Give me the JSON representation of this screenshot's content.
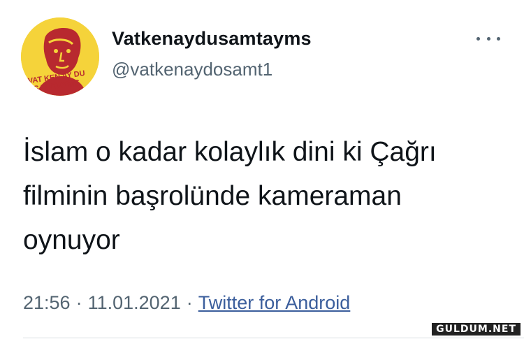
{
  "user": {
    "display_name": "Vatkenaydusamtayms",
    "handle": "@vatkenaydosamt1",
    "avatar_text": "VAT KEN AY DU SAMTAYMS",
    "avatar_bg": "#f5d33a",
    "avatar_text_color": "#b8292f"
  },
  "tweet": {
    "lines": [
      "İslam o kadar kolaylık dini ki Çağrı",
      "filminin başrolünde kameraman",
      "oynuyor"
    ]
  },
  "meta": {
    "time": "21:56",
    "separator": "·",
    "date": "11.01.2021",
    "source": "Twitter for Android"
  },
  "icons": {
    "more": "more-horizontal-icon"
  },
  "watermark": {
    "text": "GULDUM.NET"
  }
}
